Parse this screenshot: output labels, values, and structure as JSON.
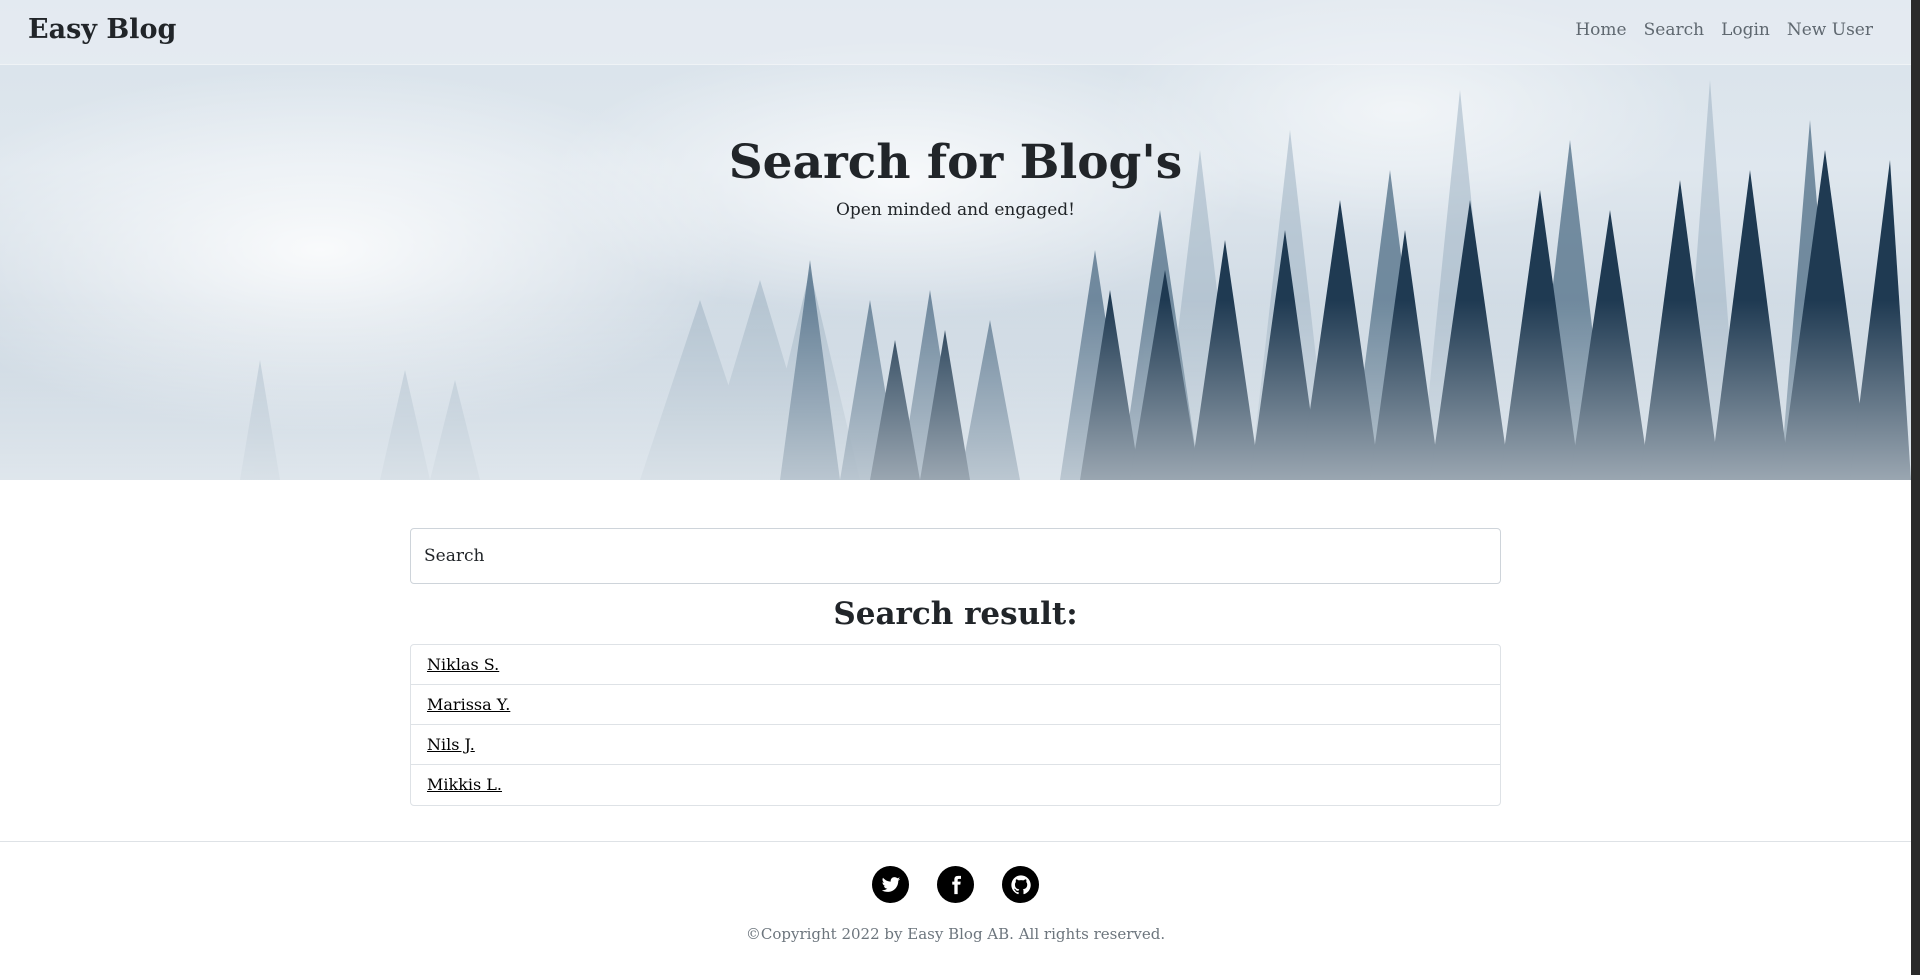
{
  "navbar": {
    "brand": "Easy Blog",
    "links": [
      {
        "label": "Home"
      },
      {
        "label": "Search"
      },
      {
        "label": "Login"
      },
      {
        "label": "New User"
      }
    ]
  },
  "hero": {
    "title": "Search for Blog's",
    "subtitle": "Open minded and engaged!"
  },
  "search": {
    "placeholder": "Search",
    "value": ""
  },
  "results": {
    "heading": "Search result:",
    "items": [
      {
        "label": "Niklas S."
      },
      {
        "label": "Marissa Y."
      },
      {
        "label": "Nils J."
      },
      {
        "label": "Mikkis L."
      }
    ]
  },
  "footer": {
    "social": [
      {
        "icon": "twitter-icon"
      },
      {
        "icon": "facebook-icon"
      },
      {
        "icon": "github-icon"
      }
    ],
    "copyright": "©Copyright 2022 by Easy Blog AB. All rights reserved."
  },
  "colors": {
    "text": "#212529",
    "muted": "#6c757d",
    "forest_dark": "#1f3a52"
  }
}
